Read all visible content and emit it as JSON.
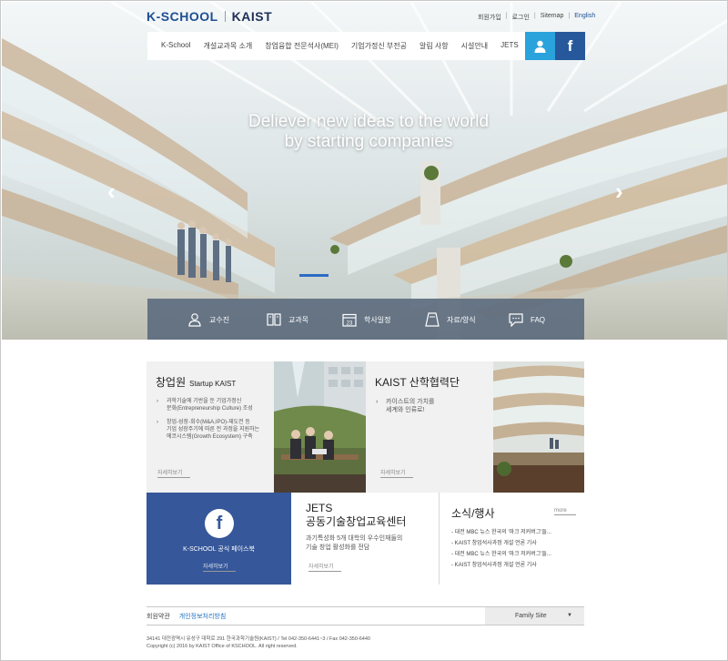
{
  "brand": {
    "name_left": "K-SCHOOL",
    "name_right": "KAIST"
  },
  "util_links": [
    "회원가입",
    "로그인",
    "Sitemap",
    "English"
  ],
  "gnb": {
    "items": [
      "K-School",
      "개설교과목 소개",
      "창업융합 전문석사(MEI)",
      "기업가정신 부전공",
      "알림 사항",
      "시설안내",
      "JETS"
    ],
    "fb_label": "f"
  },
  "hero": {
    "headline_1": "Deliever new ideas to the world",
    "headline_2": "by starting companies",
    "prev": "‹",
    "next": "›"
  },
  "quick_links": [
    "교수진",
    "교과목",
    "학사일정",
    "자료/양식",
    "FAQ"
  ],
  "quick_icons": [
    "person-icon",
    "book-icon",
    "calendar-icon",
    "document-icon",
    "chat-icon"
  ],
  "startup": {
    "title": "창업원",
    "title_en": "Startup KAIST",
    "bullets": [
      [
        "과학기술에 기반을 둔 기업가정신",
        "문화(Entrepreneurship Culture) 조성"
      ],
      [
        "창업-성장-회수(M&A,IPO)-재도전 등",
        "기업 성장주기에 따른 전 과정을 지원하는",
        "에코시스템(Growth Ecosystem) 구축"
      ]
    ],
    "more": "자세히보기"
  },
  "cooperation": {
    "title": "KAIST 산학협력단",
    "bullets": [
      [
        "카이스트의 가치를",
        "세계와 인류로!"
      ]
    ],
    "more": "자세히보기"
  },
  "facebook": {
    "label": "K-SCHOOL 공식 페이스북",
    "more": "자세히보기",
    "icon_letter": "f"
  },
  "jets": {
    "title_1": "JETS",
    "title_2": "공동기술창업교육센터",
    "desc_1": "과기특성화 5개 대학의 우수인재들의",
    "desc_2": "기술 창업 활성화를 전담",
    "more": "자세히보기"
  },
  "news": {
    "title": "소식/행사",
    "more": "more",
    "items": [
      "대전 MBC 뉴스 한국의 '마크 저커버그'들...",
      "KAIST 창업석사과정 개설 언론 기사",
      "대전 MBC 뉴스 한국의 '마크 저커버그'들...",
      "KAIST 창업석사과정 개설 언론 기사"
    ]
  },
  "footer": {
    "links": [
      "회원약관",
      "개인정보처리방침"
    ],
    "family_site": "Family Site",
    "address": "34141 대전광역시 유성구 대학로 291 한국과학기술원(KAIST) / Tel 042-350-6441~3 / Fax 042-350-6440",
    "copyright": "Copyright (c) 2016 by KAIST Office of KSCHOOL. All right reserved."
  },
  "colors": {
    "brand_blue": "#1d4f94",
    "accent_sky": "#2aa2dc",
    "facebook_blue": "#27589b",
    "panel_blue": "#36579a"
  }
}
